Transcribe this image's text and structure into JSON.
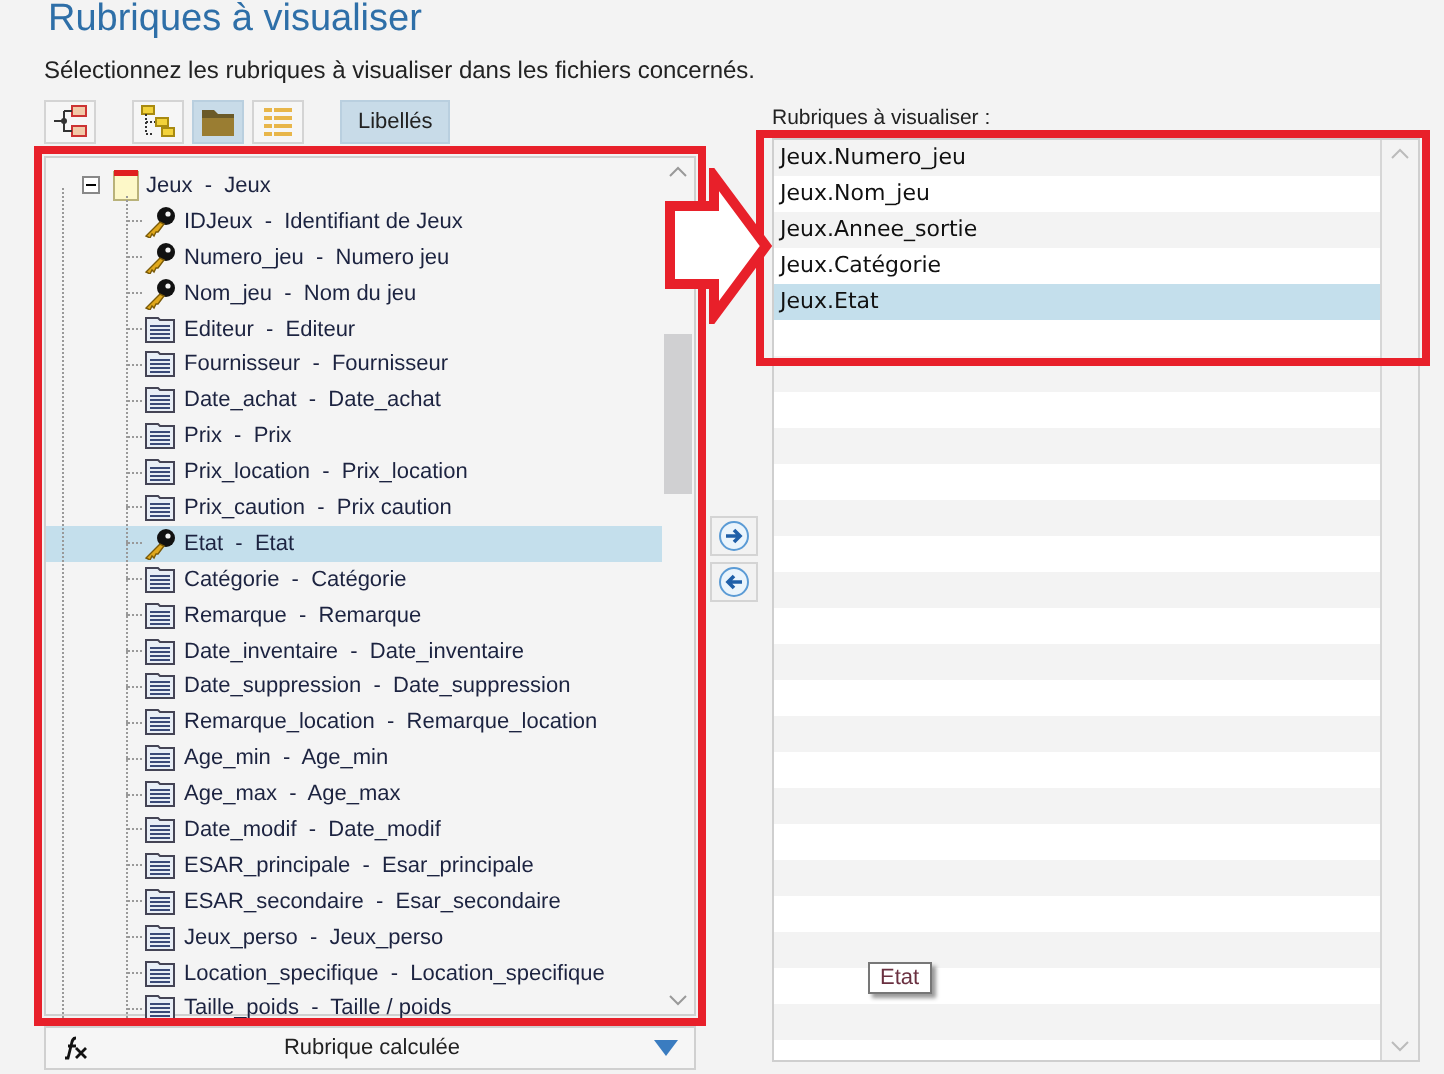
{
  "title": "Rubriques à visualiser",
  "subtitle": "Sélectionnez les rubriques à visualiser dans les fichiers concernés.",
  "toolbar": {
    "buttons": [
      {
        "selected": false
      },
      {
        "selected": false
      },
      {
        "selected": true
      },
      {
        "selected": false
      }
    ],
    "labels_toggle": {
      "label": "Libellés",
      "selected": true
    }
  },
  "tree": {
    "items": [
      {
        "label": "Jeux  -  Jeux",
        "kind": "table",
        "expanded": true,
        "selected": false,
        "children": [
          {
            "label": "IDJeux  -  Identifiant de Jeux",
            "kind": "key",
            "selected": false
          },
          {
            "label": "Numero_jeu  -  Numero jeu",
            "kind": "key",
            "selected": false
          },
          {
            "label": "Nom_jeu  -  Nom du jeu",
            "kind": "key",
            "selected": false
          },
          {
            "label": "Editeur  -  Editeur",
            "kind": "field",
            "selected": false
          },
          {
            "label": "Fournisseur  -  Fournisseur",
            "kind": "field",
            "selected": false
          },
          {
            "label": "Date_achat  -  Date_achat",
            "kind": "field",
            "selected": false
          },
          {
            "label": "Prix  -  Prix",
            "kind": "field",
            "selected": false
          },
          {
            "label": "Prix_location  -  Prix_location",
            "kind": "field",
            "selected": false
          },
          {
            "label": "Prix_caution  -  Prix caution",
            "kind": "field",
            "selected": false
          },
          {
            "label": "Etat  -  Etat",
            "kind": "key",
            "selected": true
          },
          {
            "label": "Catégorie  -  Catégorie",
            "kind": "field",
            "selected": false
          },
          {
            "label": "Remarque  -  Remarque",
            "kind": "field",
            "selected": false
          },
          {
            "label": "Date_inventaire  -  Date_inventaire",
            "kind": "field",
            "selected": false
          },
          {
            "label": "Date_suppression  -  Date_suppression",
            "kind": "field",
            "selected": false
          },
          {
            "label": "Remarque_location  -  Remarque_location",
            "kind": "field",
            "selected": false
          },
          {
            "label": "Age_min  -  Age_min",
            "kind": "field",
            "selected": false
          },
          {
            "label": "Age_max  -  Age_max",
            "kind": "field",
            "selected": false
          },
          {
            "label": "Date_modif  -  Date_modif",
            "kind": "field",
            "selected": false
          },
          {
            "label": "ESAR_principale  -  Esar_principale",
            "kind": "field",
            "selected": false
          },
          {
            "label": "ESAR_secondaire  -  Esar_secondaire",
            "kind": "field",
            "selected": false
          },
          {
            "label": "Jeux_perso  -  Jeux_perso",
            "kind": "field",
            "selected": false
          },
          {
            "label": "Location_specifique  -  Location_specifique",
            "kind": "field",
            "selected": false
          },
          {
            "label": "Taille_poids  -  Taille / poids",
            "kind": "field",
            "selected": false
          }
        ]
      }
    ]
  },
  "calculated_field": {
    "label": "Rubrique calculée"
  },
  "selected_fields": {
    "label": "Rubriques à visualiser :",
    "items": [
      {
        "label": "Jeux.Numero_jeu",
        "selected": false
      },
      {
        "label": "Jeux.Nom_jeu",
        "selected": false
      },
      {
        "label": "Jeux.Annee_sortie",
        "selected": false
      },
      {
        "label": "Jeux.Catégorie",
        "selected": false
      },
      {
        "label": "Jeux.Etat",
        "selected": true
      }
    ]
  },
  "tooltip": {
    "text": "Etat"
  }
}
